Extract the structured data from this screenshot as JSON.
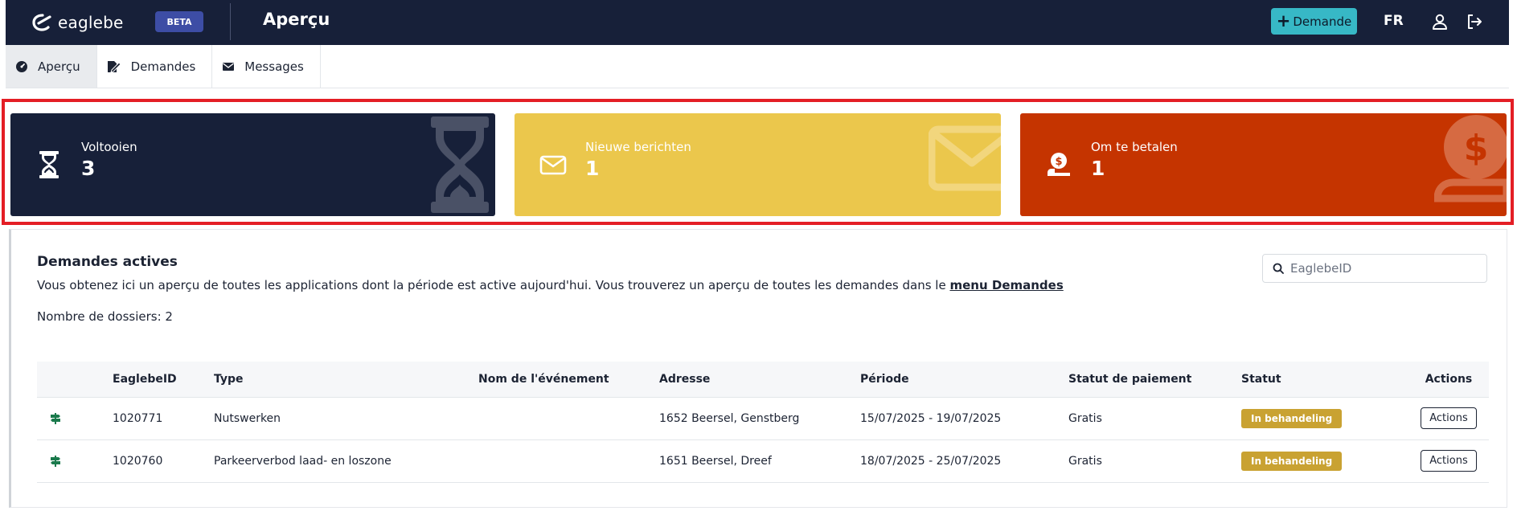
{
  "app": {
    "logo_text": "eaglebe",
    "beta_label": "BETA",
    "page_title": "Aperçu",
    "new_request_label": "Demande",
    "language": "FR"
  },
  "tabs": [
    {
      "label": "Aperçu",
      "icon": "dashboard-icon",
      "active": true
    },
    {
      "label": "Demandes",
      "icon": "file-edit-icon",
      "active": false
    },
    {
      "label": "Messages",
      "icon": "envelope-icon",
      "active": false
    }
  ],
  "cards": [
    {
      "label": "Voltooien",
      "value": "3",
      "icon": "hourglass-icon",
      "color": "#172039"
    },
    {
      "label": "Nieuwe berichten",
      "value": "1",
      "icon": "envelope-icon",
      "color": "#ebc74c"
    },
    {
      "label": "Om te betalen",
      "value": "1",
      "icon": "money-hand-icon",
      "color": "#c53400"
    }
  ],
  "panel": {
    "title": "Demandes actives",
    "description": "Vous obtenez ici un aperçu de toutes les applications dont la période est active aujourd'hui. Vous trouverez un aperçu de toutes les demandes dans le ",
    "description_link": "menu Demandes",
    "count_label": "Nombre de dossiers: 2",
    "search_placeholder": "EaglebeID"
  },
  "table": {
    "headers": [
      "",
      "EaglebeID",
      "Type",
      "Nom de l'événement",
      "Adresse",
      "Période",
      "Statut de paiement",
      "Statut",
      "Actions"
    ],
    "rows": [
      {
        "id": "1020771",
        "type": "Nutswerken",
        "event": "",
        "address": "1652 Beersel, Genstberg",
        "period": "15/07/2025 - 19/07/2025",
        "payment": "Gratis",
        "status": "In behandeling",
        "action": "Actions"
      },
      {
        "id": "1020760",
        "type": "Parkeerverbod laad- en loszone",
        "event": "",
        "address": "1651 Beersel, Dreef",
        "period": "18/07/2025 - 25/07/2025",
        "payment": "Gratis",
        "status": "In behandeling",
        "action": "Actions"
      }
    ]
  },
  "colors": {
    "topbar": "#172039",
    "accent": "#37b8c6",
    "status_badge": "#c9a232",
    "highlight": "#e41e25"
  }
}
